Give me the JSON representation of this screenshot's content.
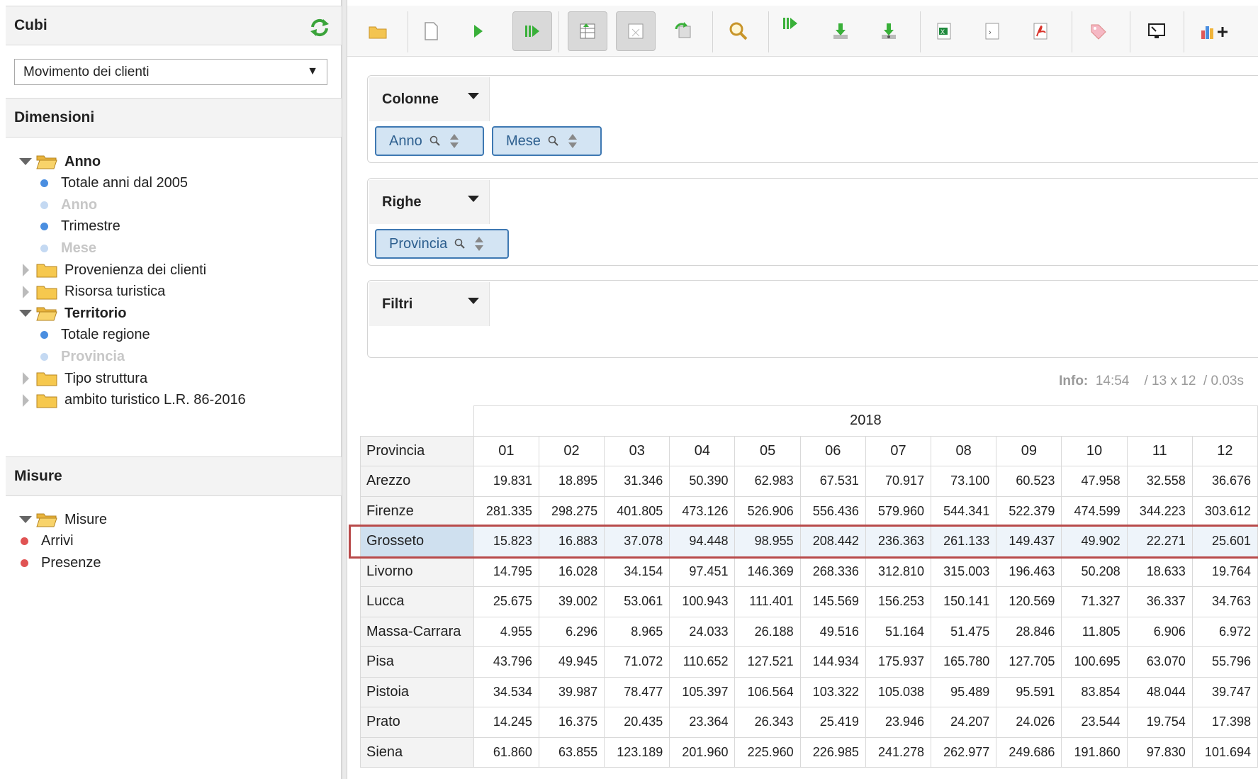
{
  "sidebar": {
    "cubes_title": "Cubi",
    "cube_selected": "Movimento dei clienti",
    "dimensions_title": "Dimensioni",
    "dimensions": [
      {
        "label": "Anno",
        "type": "folder-open"
      },
      {
        "label": "Totale anni dal 2005",
        "type": "level"
      },
      {
        "label": "Anno",
        "type": "level-dim"
      },
      {
        "label": "Trimestre",
        "type": "level"
      },
      {
        "label": "Mese",
        "type": "level-dim"
      },
      {
        "label": "Provenienza dei clienti",
        "type": "folder-closed"
      },
      {
        "label": "Risorsa turistica",
        "type": "folder-closed"
      },
      {
        "label": "Territorio",
        "type": "folder-open"
      },
      {
        "label": "Totale regione",
        "type": "level"
      },
      {
        "label": "Provincia",
        "type": "level-dim"
      },
      {
        "label": "Tipo struttura",
        "type": "folder-closed"
      },
      {
        "label": "ambito turistico L.R. 86-2016",
        "type": "folder-closed"
      }
    ],
    "measures_title": "Misure",
    "measures": [
      {
        "label": "Misure",
        "type": "folder-open"
      },
      {
        "label": "Arrivi",
        "type": "measure"
      },
      {
        "label": "Presenze",
        "type": "measure"
      }
    ]
  },
  "toolbar": {
    "icons": [
      "open-folder-icon",
      "new-query-icon",
      "run-query-icon",
      "auto-execute-icon",
      "show-fields-icon",
      "hide-empty-icon",
      "swap-axes-icon",
      "zoom-icon",
      "drillthrough-icon",
      "export-download-icon",
      "export-download-alt-icon",
      "export-excel-icon",
      "export-csv-icon",
      "export-pdf-icon",
      "tag-icon",
      "fullscreen-icon",
      "chart-add-icon"
    ]
  },
  "zones": {
    "columns": {
      "label": "Colonne",
      "chips": [
        "Anno",
        "Mese"
      ]
    },
    "rows": {
      "label": "Righe",
      "chips": [
        "Provincia"
      ]
    },
    "filters": {
      "label": "Filtri"
    }
  },
  "info": {
    "label": "Info:",
    "time": "14:54",
    "size": "/ 13 x 12",
    "duration": "/ 0.03s"
  },
  "table": {
    "year": "2018",
    "row_header": "Provincia",
    "months": [
      "01",
      "02",
      "03",
      "04",
      "05",
      "06",
      "07",
      "08",
      "09",
      "10",
      "11",
      "12"
    ],
    "rows": [
      {
        "name": "Arezzo",
        "values": [
          "19.831",
          "18.895",
          "31.346",
          "50.390",
          "62.983",
          "67.531",
          "70.917",
          "73.100",
          "60.523",
          "47.958",
          "32.558",
          "36.676"
        ]
      },
      {
        "name": "Firenze",
        "values": [
          "281.335",
          "298.275",
          "401.805",
          "473.126",
          "526.906",
          "556.436",
          "579.960",
          "544.341",
          "522.379",
          "474.599",
          "344.223",
          "303.612"
        ]
      },
      {
        "name": "Grosseto",
        "values": [
          "15.823",
          "16.883",
          "37.078",
          "94.448",
          "98.955",
          "208.442",
          "236.363",
          "261.133",
          "149.437",
          "49.902",
          "22.271",
          "25.601"
        ]
      },
      {
        "name": "Livorno",
        "values": [
          "14.795",
          "16.028",
          "34.154",
          "97.451",
          "146.369",
          "268.336",
          "312.810",
          "315.003",
          "196.463",
          "50.208",
          "18.633",
          "19.764"
        ]
      },
      {
        "name": "Lucca",
        "values": [
          "25.675",
          "39.002",
          "53.061",
          "100.943",
          "111.401",
          "145.569",
          "156.253",
          "150.141",
          "120.569",
          "71.327",
          "36.337",
          "34.763"
        ]
      },
      {
        "name": "Massa-Carrara",
        "values": [
          "4.955",
          "6.296",
          "8.965",
          "24.033",
          "26.188",
          "49.516",
          "51.164",
          "51.475",
          "28.846",
          "11.805",
          "6.906",
          "6.972"
        ]
      },
      {
        "name": "Pisa",
        "values": [
          "43.796",
          "49.945",
          "71.072",
          "110.652",
          "127.521",
          "144.934",
          "175.937",
          "165.780",
          "127.705",
          "100.695",
          "63.070",
          "55.796"
        ]
      },
      {
        "name": "Pistoia",
        "values": [
          "34.534",
          "39.987",
          "78.477",
          "105.397",
          "106.564",
          "103.322",
          "105.038",
          "95.489",
          "95.591",
          "83.854",
          "48.044",
          "39.747"
        ]
      },
      {
        "name": "Prato",
        "values": [
          "14.245",
          "16.375",
          "20.435",
          "23.364",
          "26.343",
          "25.419",
          "23.946",
          "24.207",
          "24.026",
          "23.544",
          "19.754",
          "17.398"
        ]
      },
      {
        "name": "Siena",
        "values": [
          "61.860",
          "63.855",
          "123.189",
          "201.960",
          "225.960",
          "226.985",
          "241.278",
          "262.977",
          "249.686",
          "191.860",
          "97.830",
          "101.694"
        ]
      }
    ],
    "selected_row": "Grosseto"
  },
  "colors": {
    "accent": "#3e78b2",
    "chip_bg": "#d3e4f3",
    "highlight": "#b84a4a"
  }
}
